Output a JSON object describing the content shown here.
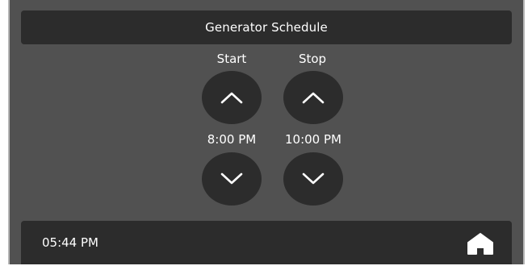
{
  "header": {
    "title": "Generator Schedule"
  },
  "schedule": {
    "start": {
      "label": "Start",
      "time": "8:00 PM"
    },
    "stop": {
      "label": "Stop",
      "time": "10:00 PM"
    }
  },
  "footer": {
    "clock": "05:44 PM"
  },
  "icons": {
    "up": "chevron-up-icon",
    "down": "chevron-down-icon",
    "home": "home-icon"
  },
  "colors": {
    "background": "#515151",
    "panel": "#2c2c2c",
    "text": "#ffffff"
  }
}
